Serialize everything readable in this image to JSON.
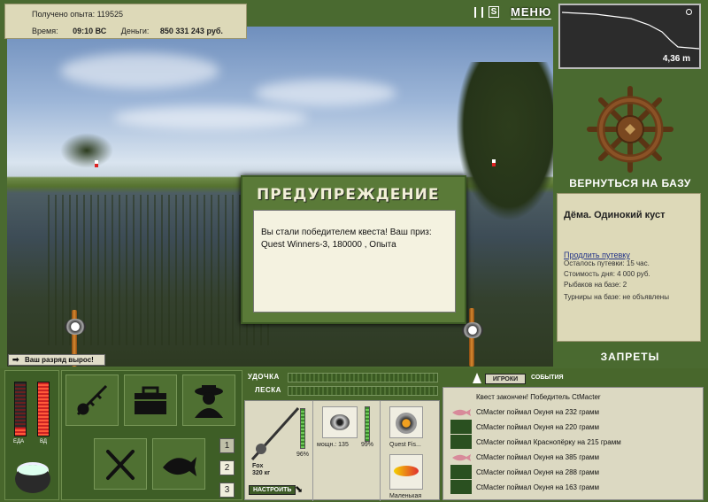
{
  "hud": {
    "xp_label": "Получено опыта:",
    "xp_value": "119525",
    "time_label": "Время:",
    "time_value": "09:10 ВС",
    "money_label": "Деньги:",
    "money_value": "850 331 243 руб.",
    "menu_label": "МЕНЮ"
  },
  "depth": {
    "value": "4,36 m"
  },
  "base": {
    "back_label": "ВЕРНУТЬСЯ НА БАЗУ",
    "location": "Дёма. Одинокий куст",
    "extend_link": "Продлить путевку",
    "lines": [
      "Осталось путевки: 15 час.",
      "Стоимость дня: 4 000 руб.",
      "Рыбаков на базе: 2",
      "Турниры на базе: не объявлены"
    ],
    "bans_label": "ЗАПРЕТЫ"
  },
  "warning": {
    "title": "ПРЕДУПРЕЖДЕНИЕ",
    "text": "Вы стали победителем квеста! Ваш приз: Quest Winners-3, 180000 , Опыта"
  },
  "rank_notice": "Ваш разряд вырос!",
  "gauges": {
    "food_label": "ЕДА",
    "vd_label": "ВД",
    "food_level": 0.15,
    "vd_level": 1.0
  },
  "gear": {
    "rod_label": "УДОЧКА",
    "line_label": "ЛЕСКА",
    "rod_name": "Fox",
    "rod_weight": "320 кг",
    "rod_pct": "96%",
    "reel_power": "мощн.: 135",
    "reel_pct": "99%",
    "lure1": "Quest Fis...",
    "lure2": "Маленькая",
    "setup_label": "НАСТРОИТЬ"
  },
  "slot_buttons": [
    "1",
    "2",
    "3"
  ],
  "chat": {
    "players_tab": "ИГРОКИ",
    "events_tab": "СОБЫТИЯ",
    "messages": [
      "Квест закончен! Победитель CtMacter",
      "CtMacter поймал Окуня на 232 грамм",
      "CtMacter поймал Окуня на 220 грамм",
      "CtMacter поймал Краснопёрку на 215 грамм",
      "CtMacter поймал Окуня на 385 грамм",
      "CtMacter поймал Окуня на 288 грамм",
      "CtMacter поймал Окуня на 163 грамм"
    ]
  },
  "colors": {
    "panel": "#48672c",
    "paper": "#ddd9b8",
    "accent": "#3d5a26"
  }
}
